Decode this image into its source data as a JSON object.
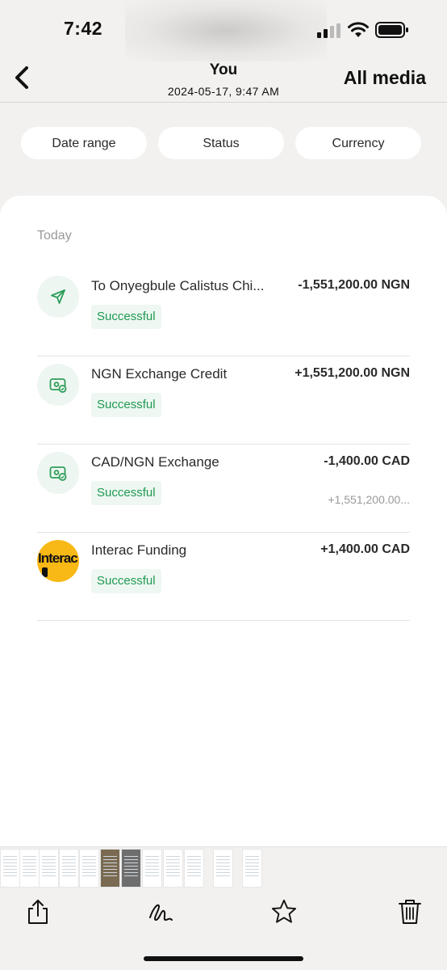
{
  "status_bar": {
    "time": "7:42"
  },
  "header": {
    "title": "You",
    "subtitle": "2024-05-17, 9:47 AM",
    "all_media_label": "All media"
  },
  "filters": [
    "Date range",
    "Status",
    "Currency"
  ],
  "section": {
    "label": "Today"
  },
  "transactions": [
    {
      "title": "To Onyegbule Calistus Chi...",
      "amount": "-1,551,200.00 NGN",
      "status": "Successful",
      "icon": "send-arrow-icon"
    },
    {
      "title": "NGN Exchange Credit",
      "amount": "+1,551,200.00 NGN",
      "status": "Successful",
      "icon": "exchange-icon"
    },
    {
      "title": "CAD/NGN Exchange",
      "amount": "-1,400.00 CAD",
      "sub_amount": "+1,551,200.00...",
      "status": "Successful",
      "icon": "exchange-icon"
    },
    {
      "title": "Interac Funding",
      "amount": "+1,400.00 CAD",
      "status": "Successful",
      "icon": "interac-logo",
      "logo_text": "Interac"
    }
  ],
  "colors": {
    "success_text": "#1f9a52",
    "success_bg": "#eef7f1",
    "icon_bg": "#eef6f1",
    "interac_yellow": "#f8b815"
  },
  "toolbar": {
    "icons": [
      "share-icon",
      "markup-icon",
      "star-icon",
      "trash-icon"
    ]
  }
}
